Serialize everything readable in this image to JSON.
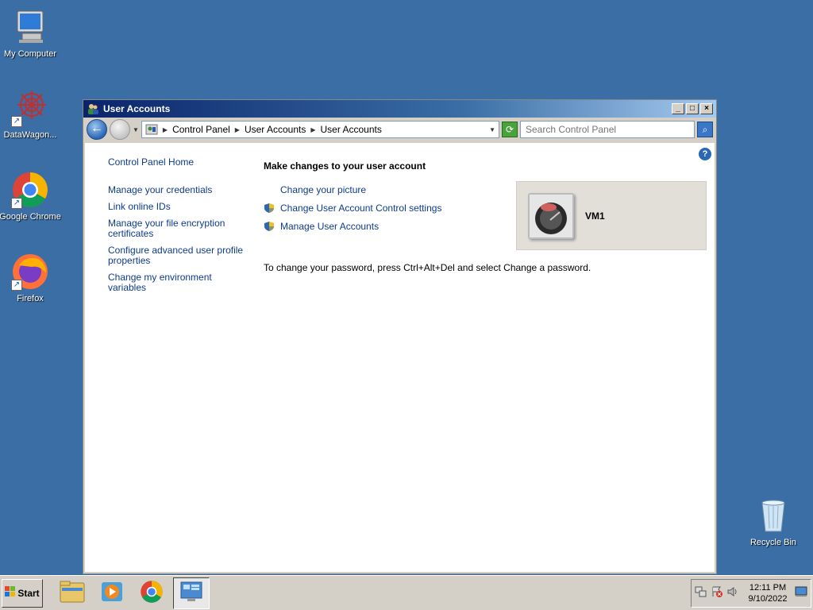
{
  "desktop": {
    "icons": [
      {
        "label": "My Computer"
      },
      {
        "label": "DataWagon..."
      },
      {
        "label": "Google Chrome"
      },
      {
        "label": "Firefox"
      },
      {
        "label": "Recycle Bin"
      }
    ]
  },
  "window": {
    "title": "User Accounts",
    "address": {
      "crumbs": [
        "Control Panel",
        "User Accounts",
        "User Accounts"
      ]
    },
    "search": {
      "placeholder": "Search Control Panel"
    },
    "left_pane": {
      "home": "Control Panel Home",
      "tasks": [
        "Manage your credentials",
        "Link online IDs",
        "Manage your file encryption certificates",
        "Configure advanced user profile properties",
        "Change my environment variables"
      ]
    },
    "main": {
      "heading": "Make changes to your user account",
      "links": [
        "Change your picture",
        "Change User Account Control settings",
        "Manage User Accounts"
      ],
      "note": "To change your password, press Ctrl+Alt+Del and select Change a password."
    },
    "user": {
      "name": "VM1"
    }
  },
  "taskbar": {
    "start_label": "Start",
    "clock_time": "12:11 PM",
    "clock_date": "9/10/2022"
  },
  "colors": {
    "desktop": "#3a6ea5",
    "link": "#0d3b8c"
  }
}
